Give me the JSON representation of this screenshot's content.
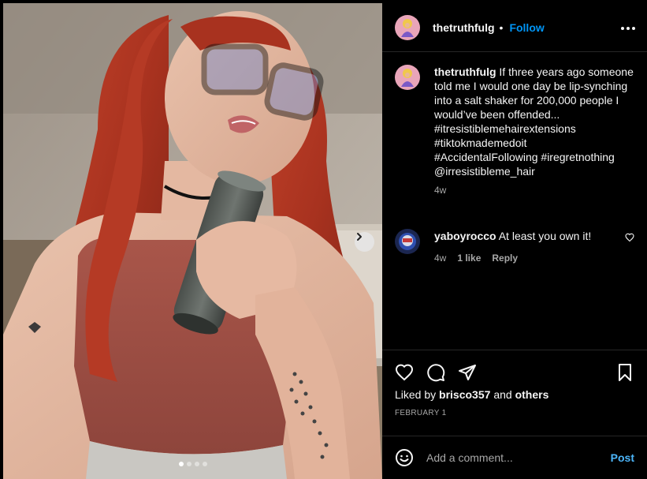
{
  "post": {
    "username": "thetruthfulg",
    "follow_label": "Follow",
    "separator": "•",
    "caption": "If three years ago someone told me I would one day be lip-synching into a salt shaker for 200,000 people I would’ve been offended...\n#itresistiblemehairextensions\n#tiktokmademedoit\n#AccidentalFollowing #iregretnothing\n@irresistibleme_hair",
    "caption_age": "4w",
    "media_slides": 4,
    "active_slide": 1
  },
  "comment": {
    "username": "yaboyrocco",
    "text": "At least you own it!",
    "age": "4w",
    "likes": "1 like",
    "reply_label": "Reply"
  },
  "engagement": {
    "liked_by_prefix": "Liked by",
    "liked_by_user": "brisco357",
    "and_label": "and",
    "others_label": "others",
    "date": "FEBRUARY 1"
  },
  "composer": {
    "placeholder": "Add a comment...",
    "post_label": "Post"
  },
  "icons": {
    "more": "more-horizontal-icon",
    "next": "chevron-right-icon",
    "like": "heart-icon",
    "comment": "comment-bubble-icon",
    "share": "paper-plane-icon",
    "save": "bookmark-icon",
    "emoji": "smiley-icon"
  },
  "colors": {
    "background": "#000000",
    "link": "#0095f6",
    "post_button": "#4cb5f9",
    "muted": "#a8a8a8",
    "divider": "#262626"
  }
}
